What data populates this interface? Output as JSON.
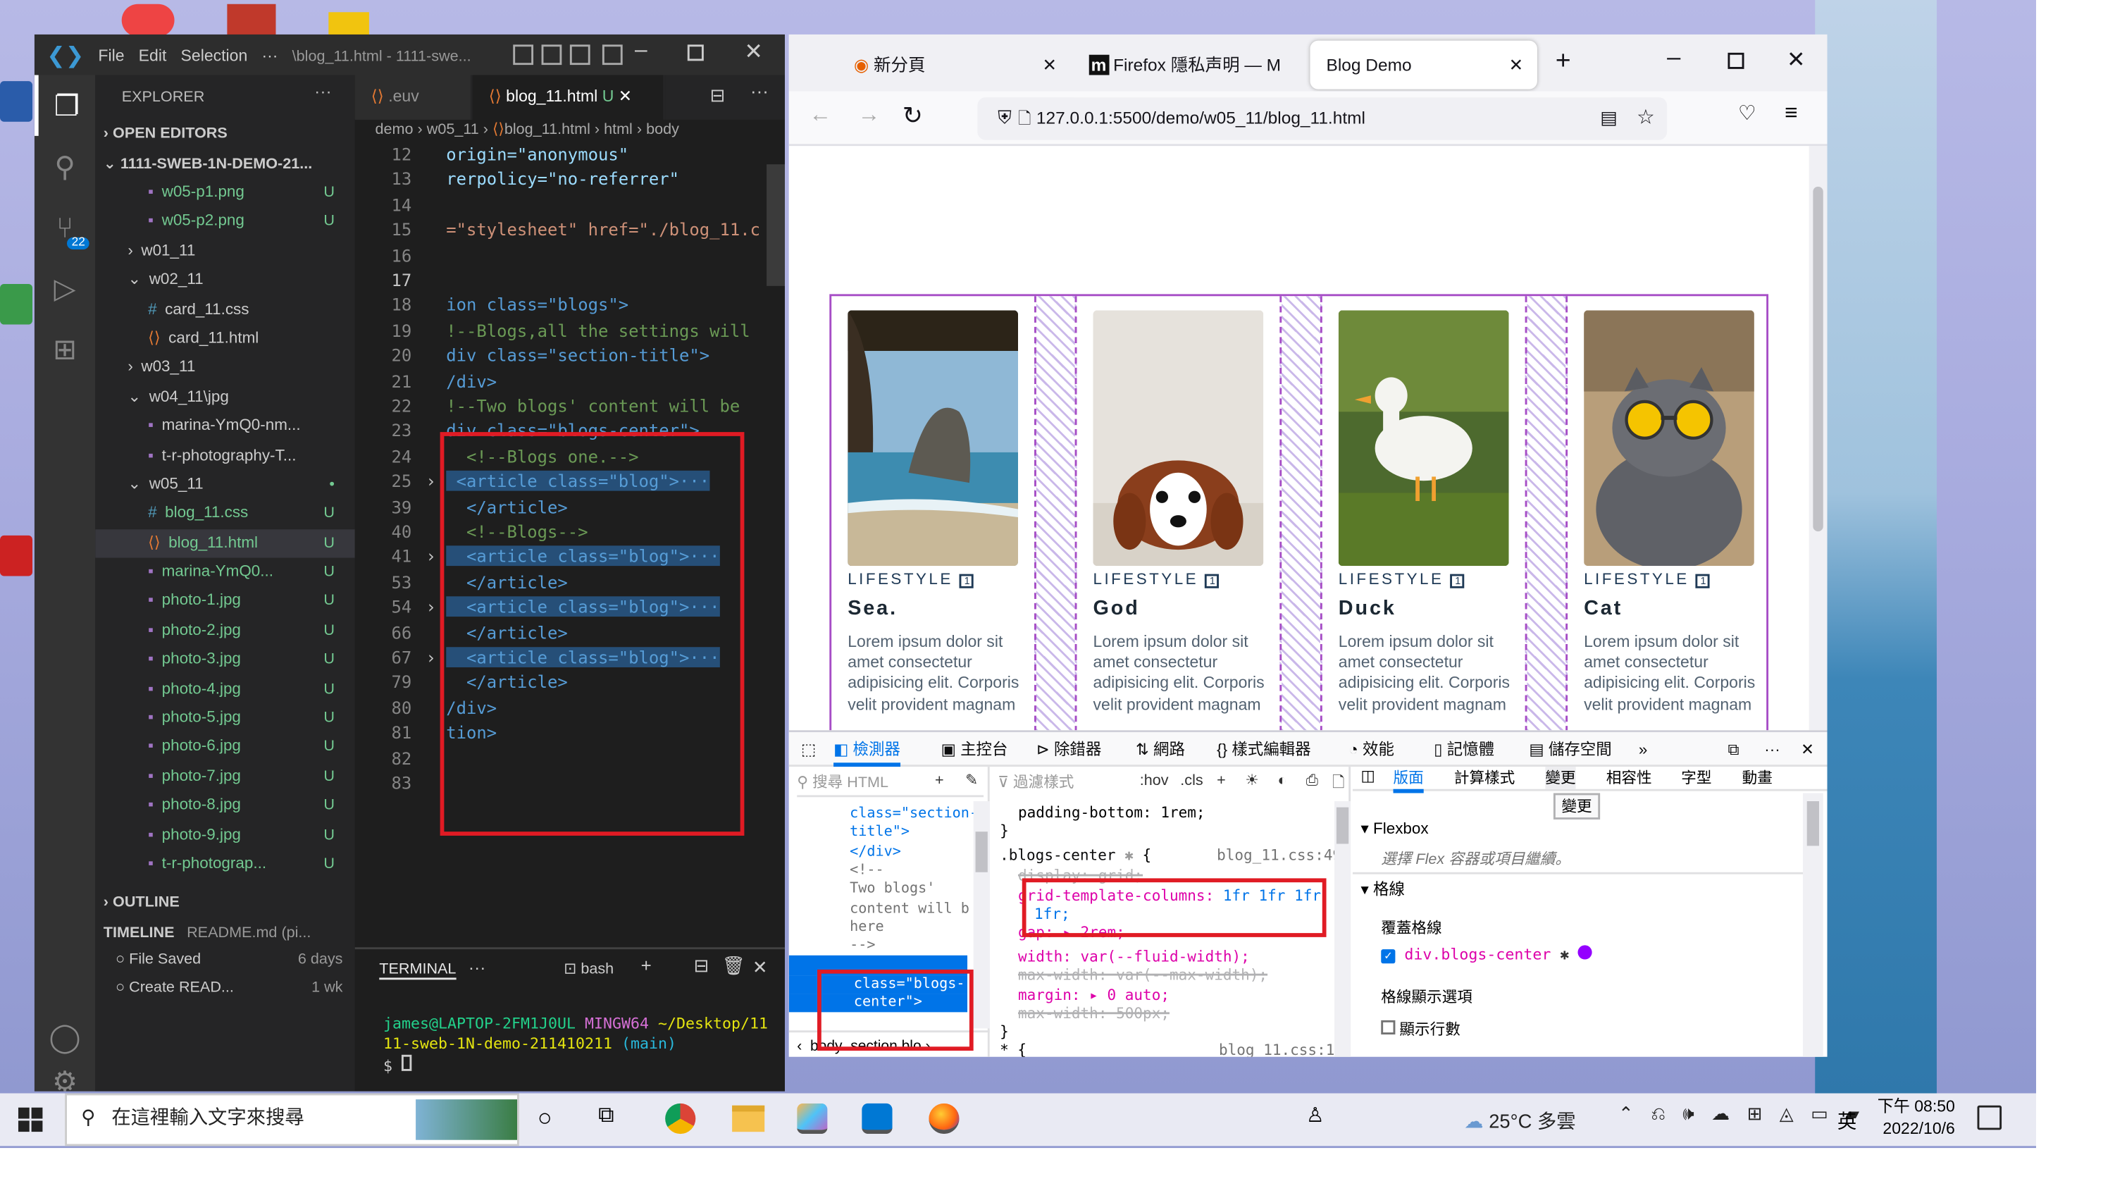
{
  "colors": {
    "vscode_bg": "#1e1e1e",
    "accent_blue": "#0078d4",
    "highlight_red": "#e01b24",
    "grid_purple": "#a64dc6"
  },
  "vscode": {
    "menu": [
      "File",
      "Edit",
      "Selection"
    ],
    "title": "\\blog_11.html - 1111-swe...",
    "explorer_title": "EXPLORER",
    "open_editors": "OPEN EDITORS",
    "project": "1111-SWEB-1N-DEMO-21...",
    "tree": [
      {
        "label": "w05-p1.png",
        "status": "U",
        "indent": 2,
        "icon": "image-icon"
      },
      {
        "label": "w05-p2.png",
        "status": "U",
        "indent": 2,
        "icon": "image-icon"
      },
      {
        "label": "w01_11",
        "status": "",
        "indent": 1,
        "icon": "folder-closed-icon"
      },
      {
        "label": "w02_11",
        "status": "",
        "indent": 1,
        "icon": "folder-open-icon"
      },
      {
        "label": "card_11.css",
        "status": "",
        "indent": 2,
        "icon": "css-icon"
      },
      {
        "label": "card_11.html",
        "status": "",
        "indent": 2,
        "icon": "html-icon"
      },
      {
        "label": "w03_11",
        "status": "",
        "indent": 1,
        "icon": "folder-closed-icon"
      },
      {
        "label": "w04_11\\jpg",
        "status": "",
        "indent": 1,
        "icon": "folder-open-icon"
      },
      {
        "label": "marina-YmQ0-nm...",
        "status": "",
        "indent": 2,
        "icon": "image-icon"
      },
      {
        "label": "t-r-photography-T...",
        "status": "",
        "indent": 2,
        "icon": "image-icon"
      },
      {
        "label": "w05_11",
        "status": "•",
        "indent": 1,
        "icon": "folder-open-icon"
      },
      {
        "label": "blog_11.css",
        "status": "U",
        "indent": 2,
        "icon": "css-icon"
      },
      {
        "label": "blog_11.html",
        "status": "U",
        "indent": 2,
        "icon": "html-icon",
        "selected": true
      },
      {
        "label": "marina-YmQ0...",
        "status": "U",
        "indent": 2,
        "icon": "image-icon"
      },
      {
        "label": "photo-1.jpg",
        "status": "U",
        "indent": 2,
        "icon": "image-icon"
      },
      {
        "label": "photo-2.jpg",
        "status": "U",
        "indent": 2,
        "icon": "image-icon"
      },
      {
        "label": "photo-3.jpg",
        "status": "U",
        "indent": 2,
        "icon": "image-icon"
      },
      {
        "label": "photo-4.jpg",
        "status": "U",
        "indent": 2,
        "icon": "image-icon"
      },
      {
        "label": "photo-5.jpg",
        "status": "U",
        "indent": 2,
        "icon": "image-icon"
      },
      {
        "label": "photo-6.jpg",
        "status": "U",
        "indent": 2,
        "icon": "image-icon"
      },
      {
        "label": "photo-7.jpg",
        "status": "U",
        "indent": 2,
        "icon": "image-icon"
      },
      {
        "label": "photo-8.jpg",
        "status": "U",
        "indent": 2,
        "icon": "image-icon"
      },
      {
        "label": "photo-9.jpg",
        "status": "U",
        "indent": 2,
        "icon": "image-icon"
      },
      {
        "label": "t-r-photograp...",
        "status": "U",
        "indent": 2,
        "icon": "image-icon"
      }
    ],
    "outline": "OUTLINE",
    "timeline": "TIMELINE",
    "timeline_file": "README.md (pi...",
    "timeline_items": [
      {
        "label": "File Saved",
        "when": "6 days"
      },
      {
        "label": "Create READ...",
        "when": "1 wk"
      }
    ],
    "tabs": [
      {
        "label": ".euv",
        "active": false
      },
      {
        "label": "blog_11.html",
        "status": "U",
        "active": true
      }
    ],
    "breadcrumb": [
      "demo",
      "w05_11",
      "blog_11.html",
      "html",
      "body"
    ],
    "code": [
      {
        "n": "12",
        "t": "origin=\"anonymous\"",
        "c": "attr"
      },
      {
        "n": "13",
        "t": "rerpolicy=\"no-referrer\"",
        "c": "attr"
      },
      {
        "n": "14",
        "t": "",
        "c": "txt"
      },
      {
        "n": "15",
        "t": "=\"stylesheet\" href=\"./blog_11.c",
        "c": "str"
      },
      {
        "n": "16",
        "t": "",
        "c": "txt"
      },
      {
        "n": "17",
        "t": "",
        "c": "txt",
        "cur": true
      },
      {
        "n": "18",
        "t": "ion class=\"blogs\">",
        "c": "tag"
      },
      {
        "n": "19",
        "t": "!--Blogs,all the settings will",
        "c": "cmt"
      },
      {
        "n": "20",
        "t": "div class=\"section-title\">",
        "c": "tag"
      },
      {
        "n": "21",
        "t": "/div>",
        "c": "tag"
      },
      {
        "n": "22",
        "t": "!--Two blogs' content will be",
        "c": "cmt"
      },
      {
        "n": "23",
        "t": "div class=\"blogs-center\">",
        "c": "tag"
      },
      {
        "n": "24",
        "t": "  <!--Blogs one.-->",
        "c": "cmt"
      },
      {
        "n": "25",
        "t": " <article class=\"blog\">···",
        "c": "tag",
        "hl": true,
        "fold": true
      },
      {
        "n": "39",
        "t": "  </article>",
        "c": "tag"
      },
      {
        "n": "40",
        "t": "  <!--Blogs-->",
        "c": "cmt"
      },
      {
        "n": "41",
        "t": "  <article class=\"blog\">···",
        "c": "tag",
        "hl": true,
        "fold": true
      },
      {
        "n": "53",
        "t": "  </article>",
        "c": "tag"
      },
      {
        "n": "54",
        "t": "  <article class=\"blog\">···",
        "c": "tag",
        "hl": true,
        "fold": true
      },
      {
        "n": "66",
        "t": "  </article>",
        "c": "tag"
      },
      {
        "n": "67",
        "t": "  <article class=\"blog\">···",
        "c": "tag",
        "hl": true,
        "fold": true
      },
      {
        "n": "79",
        "t": "  </article>",
        "c": "tag"
      },
      {
        "n": "80",
        "t": "/div>",
        "c": "tag"
      },
      {
        "n": "81",
        "t": "tion>",
        "c": "tag"
      },
      {
        "n": "82",
        "t": "",
        "c": "txt"
      },
      {
        "n": "83",
        "t": "",
        "c": "txt"
      }
    ],
    "terminal": {
      "tab": "TERMINAL",
      "shell": "bash",
      "prompt_user": "james@LAPTOP-2FM1J0UL",
      "prompt_env": "MINGW64",
      "prompt_path": "~/Desktop/11",
      "prompt_path2": "11-sweb-1N-demo-211410211",
      "prompt_branch": "(main)",
      "prompt_char": "$"
    },
    "badge": "22"
  },
  "firefox": {
    "tabs": [
      {
        "label": "新分頁"
      },
      {
        "label": "Firefox 隱私声明 — M"
      },
      {
        "label": "Blog Demo",
        "active": true
      }
    ],
    "url": "127.0.0.1:5500/demo/w05_11/blog_11.html",
    "cards": [
      {
        "category": "LIFESTYLE",
        "title": "Sea.",
        "desc": "Lorem ipsum dolor sit amet consectetur adipisicing elit. Corporis velit provident magnam",
        "img": "sea-photo"
      },
      {
        "category": "LIFESTYLE",
        "title": "God",
        "desc": "Lorem ipsum dolor sit amet consectetur adipisicing elit. Corporis velit provident magnam",
        "img": "dog-photo"
      },
      {
        "category": "LIFESTYLE",
        "title": "Duck",
        "desc": "Lorem ipsum dolor sit amet consectetur adipisicing elit. Corporis velit provident magnam",
        "img": "duck-photo"
      },
      {
        "category": "LIFESTYLE",
        "title": "Cat",
        "desc": "Lorem ipsum dolor sit amet consectetur adipisicing elit. Corporis velit provident magnam",
        "img": "cat-photo"
      }
    ],
    "devtools": {
      "tabs": [
        "檢測器",
        "主控台",
        "除錯器",
        "網路",
        "樣式編輯器",
        "效能",
        "記憶體",
        "儲存空間"
      ],
      "search_placeholder": "搜尋 HTML",
      "filter_placeholder": "過濾樣式",
      "hov": ":hov",
      "cls": ".cls",
      "layout_tabs": [
        "版面",
        "計算樣式",
        "變更",
        "相容性",
        "字型",
        "動畫"
      ],
      "dom_lines": [
        "class=\"section-",
        "title\">",
        "</div>",
        "<!--",
        "Two blogs'",
        "content will b",
        "here",
        "-->",
        "<div",
        "class=\"blogs-",
        "center\">"
      ],
      "dom_crumbs": [
        "body",
        "section.blo"
      ],
      "rules": {
        "padding_bottom": "padding-bottom: 1rem;",
        "selector": ".blogs-center",
        "file": "blog_11.css:49",
        "display": "display: grid;",
        "gtc_name": "grid-template-columns:",
        "gtc_value": "1fr 1fr 1fr",
        "gtc_value2": "1fr;",
        "gap": "gap: ▸ 2rem;",
        "width": "width: var(--fluid-width);",
        "maxw1": "max-width: var(--max-width);",
        "margin": "margin: ▸ 0 auto;",
        "maxw2": "max-width: 500px;",
        "file2": "blog_11.css:1",
        "brace": "}",
        "open": "* {"
      },
      "layout": {
        "change_btn": "變更",
        "flexbox": "Flexbox",
        "flex_hint": "選擇 Flex 容器或項目繼續。",
        "grid": "格線",
        "overlay": "覆蓋格線",
        "grid_item": "div.blogs-center",
        "display_opts": "格線顯示選項",
        "show_lines": "顯示行數"
      }
    }
  },
  "taskbar": {
    "search_placeholder": "在這裡輸入文字來搜尋",
    "weather": "25°C 多雲",
    "lang": "英",
    "time": "下午 08:50",
    "date": "2022/10/6"
  }
}
